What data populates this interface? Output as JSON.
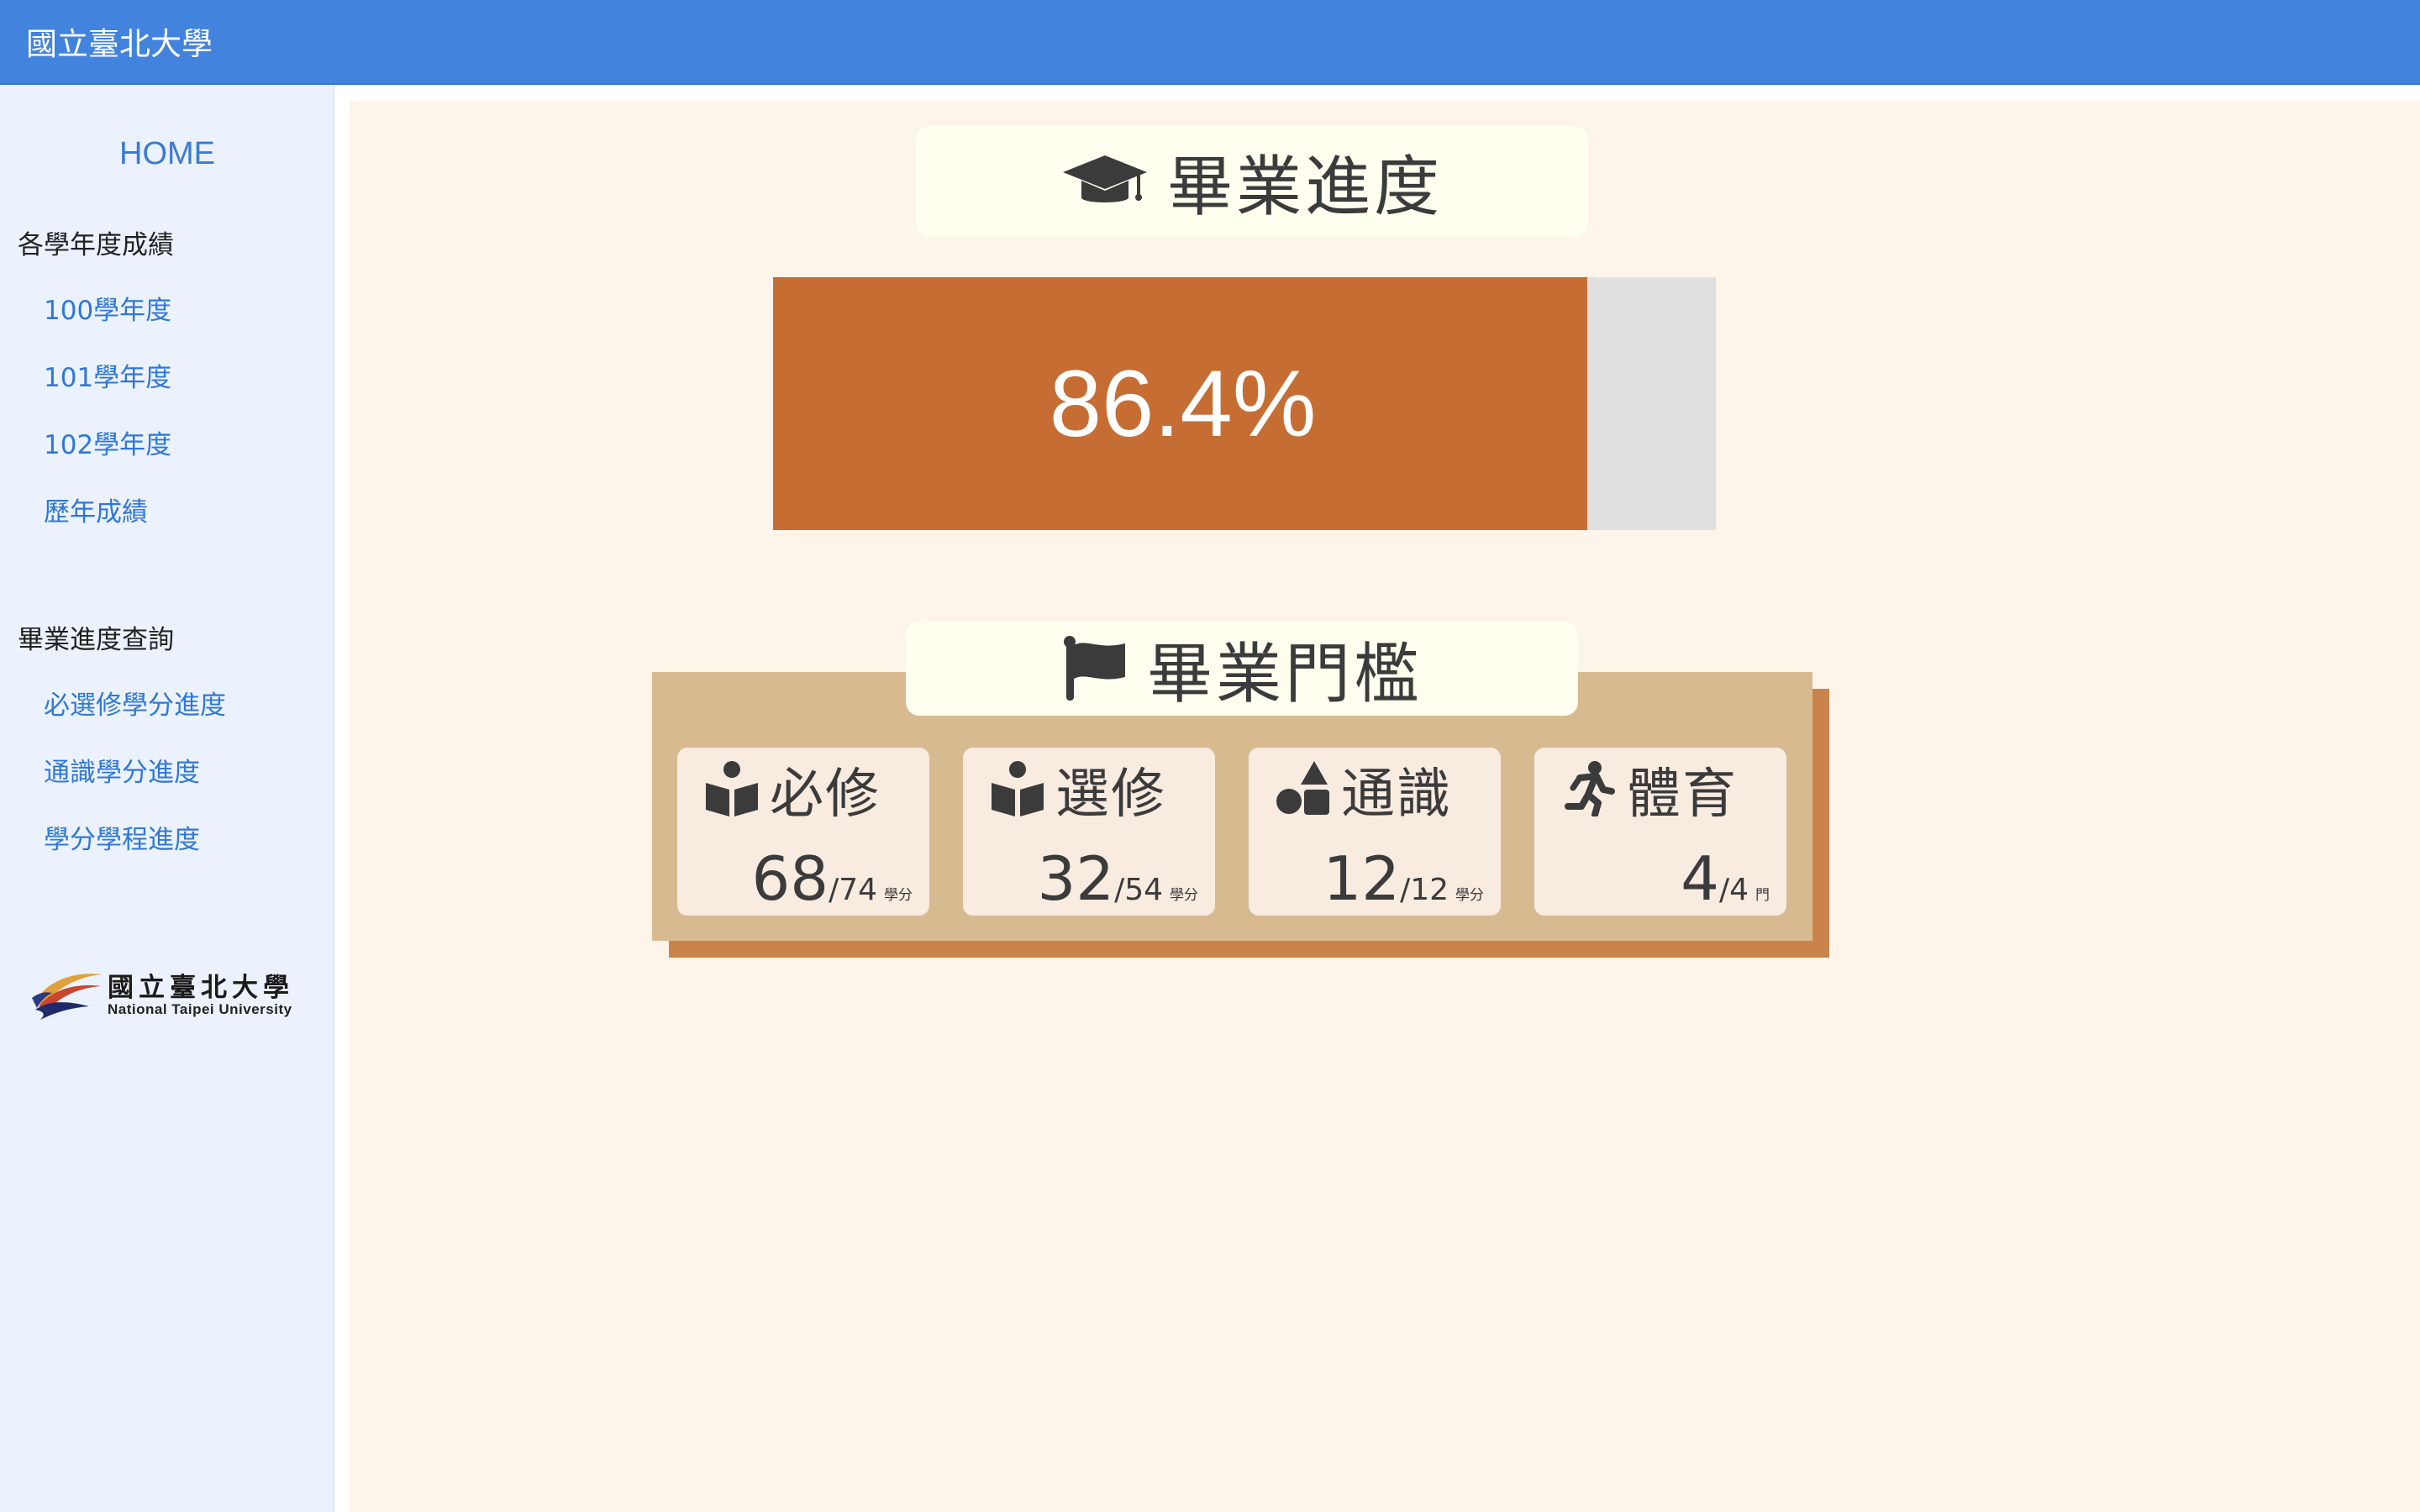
{
  "header": {
    "title": "國立臺北大學"
  },
  "sidebar": {
    "home_label": "HOME",
    "sections": [
      {
        "heading": "各學年度成績",
        "links": [
          "100學年度",
          "101學年度",
          "102學年度",
          "歷年成績"
        ]
      },
      {
        "heading": "畢業進度查詢",
        "links": [
          "必選修學分進度",
          "通識學分進度",
          "學分學程進度"
        ]
      }
    ],
    "logo": {
      "name_cn": "國立臺北大學",
      "name_en": "National Taipei University"
    }
  },
  "progress": {
    "title": "畢業進度",
    "icon": "graduation-cap-icon",
    "percent_label": "86.4%",
    "percent": 86.4,
    "fill_color": "#c66d33",
    "track_color": "#e0e0e0"
  },
  "threshold": {
    "title": "畢業門檻",
    "icon": "flag-icon",
    "cards": [
      {
        "label": "必修",
        "icon": "book-reader-icon",
        "earned": "68",
        "required": "/74",
        "unit": "學分"
      },
      {
        "label": "選修",
        "icon": "book-reader-icon",
        "earned": "32",
        "required": "/54",
        "unit": "學分"
      },
      {
        "label": "通識",
        "icon": "shapes-icon",
        "earned": "12",
        "required": "/12",
        "unit": "學分"
      },
      {
        "label": "體育",
        "icon": "running-icon",
        "earned": "4",
        "required": "/4",
        "unit": "門"
      }
    ]
  },
  "colors": {
    "header_bg": "#4283dd",
    "sidebar_bg": "#ecf2fd",
    "main_bg": "#fdf4ea",
    "panel_bg": "#d8ba91",
    "panel_shadow": "#c8844a",
    "card_bg": "#f8ebe0"
  }
}
